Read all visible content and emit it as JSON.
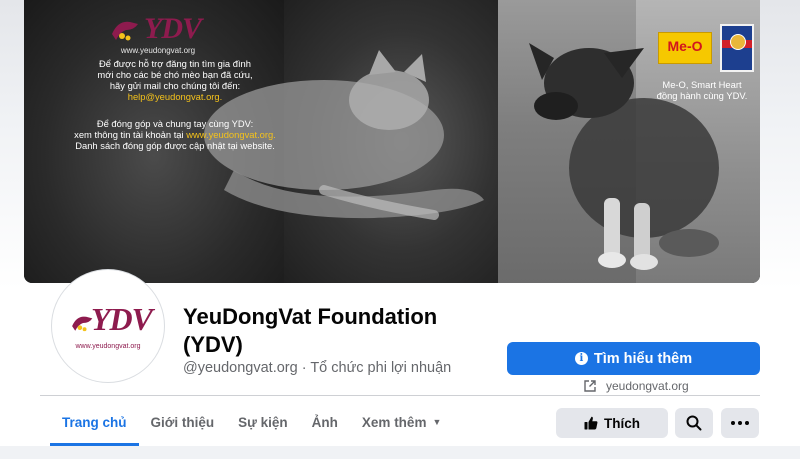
{
  "cover": {
    "logo_text": "YDV",
    "logo_url": "www.yeudongvat.org",
    "support_lines": [
      "Để được hỗ trợ đăng tin tìm gia đình",
      "mới cho các bé chó mèo bạn đã cứu,",
      "hãy gửi mail cho chúng tôi đến:"
    ],
    "support_email": "help@yeudongvat.org.",
    "donate_intro": "Để đóng góp và chung tay cùng YDV:",
    "donate_line_prefix": "xem thông tin tài khoản tại ",
    "donate_link": "www.yeudongvat.org.",
    "donate_update": "Danh sách đóng góp được cập nhật tại website.",
    "sponsor_meo": "Me-O",
    "sponsor_line1": "Me-O, Smart Heart",
    "sponsor_line2": "đồng hành cùng YDV."
  },
  "avatar": {
    "logo_text": "YDV",
    "logo_url": "www.yeudongvat.org"
  },
  "page": {
    "title": "YeuDongVat Foundation (YDV)",
    "handle": "@yeudongvat.org",
    "separator": " · ",
    "category": "Tổ chức phi lợi nhuận",
    "cta_label": "Tìm hiểu thêm",
    "website": "yeudongvat.org"
  },
  "tabs": [
    {
      "label": "Trang chủ",
      "active": true
    },
    {
      "label": "Giới thiệu",
      "active": false
    },
    {
      "label": "Sự kiện",
      "active": false
    },
    {
      "label": "Ảnh",
      "active": false
    },
    {
      "label": "Xem thêm",
      "active": false
    }
  ],
  "actions": {
    "like_label": "Thích"
  },
  "colors": {
    "accent": "#1b74e4",
    "brand": "#8e1b4e",
    "highlight": "#f4c21b"
  }
}
